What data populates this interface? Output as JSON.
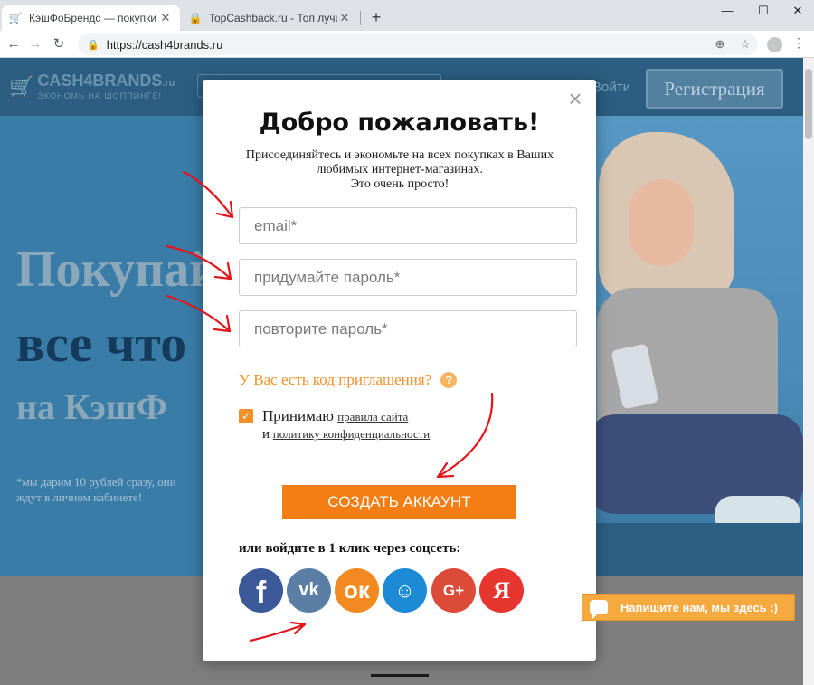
{
  "browser": {
    "tabs": [
      {
        "title": "КэшФоБрендс — покупки с кэш",
        "close": "✕"
      },
      {
        "title": "TopCashback.ru - Топ лучших кэ",
        "close": "✕"
      }
    ],
    "new_tab": "+",
    "window_controls": {
      "minimize": "—",
      "maximize": "☐",
      "close": "✕"
    },
    "url": "https://cash4brands.ru"
  },
  "site": {
    "logo_brand": "CASH4BRANDS",
    "logo_suffix": ".ru",
    "logo_slogan": "ЭКОНОМЬ НА ШОППИНГЕ!",
    "login": "Войти",
    "register": "Регистрация",
    "hero": {
      "line1": "Покупай",
      "line2": "все что",
      "line3": "на КэшФ",
      "note": "*мы дарим 10 рублей сразу, они ждут в личном кабинете!"
    },
    "chat": "Напишите нам, мы здесь :)"
  },
  "modal": {
    "close": "×",
    "title": "Добро пожаловать!",
    "subtitle_line1": "Присоединяйтесь и экономьте на всех покупках в Ваших",
    "subtitle_line2": "любимых интернет-магазинах.",
    "subtitle_line3": "Это очень просто!",
    "fields": {
      "email_placeholder": "email*",
      "password_placeholder": "придумайте пароль*",
      "repeat_placeholder": "повторите пароль*"
    },
    "invite": "У Вас есть код приглашения?",
    "invite_icon": "?",
    "agree": {
      "checked": "✓",
      "accept": "Принимаю",
      "rules_link": "правила сайта",
      "and": "и",
      "policy_link": "политику конфиденциальности"
    },
    "create_button": "СОЗДАТЬ АККАУНТ",
    "social_title": "или войдите в 1 клик через соцсеть:",
    "social": {
      "facebook": "f",
      "vk": "vk",
      "odnoklassniki": "ок",
      "mailru": "☺",
      "google": "G+",
      "yandex": "Я"
    }
  },
  "colors": {
    "accent": "#f47d14",
    "annotation_red": "#e0161c",
    "header_bg": "#2b5e80"
  }
}
